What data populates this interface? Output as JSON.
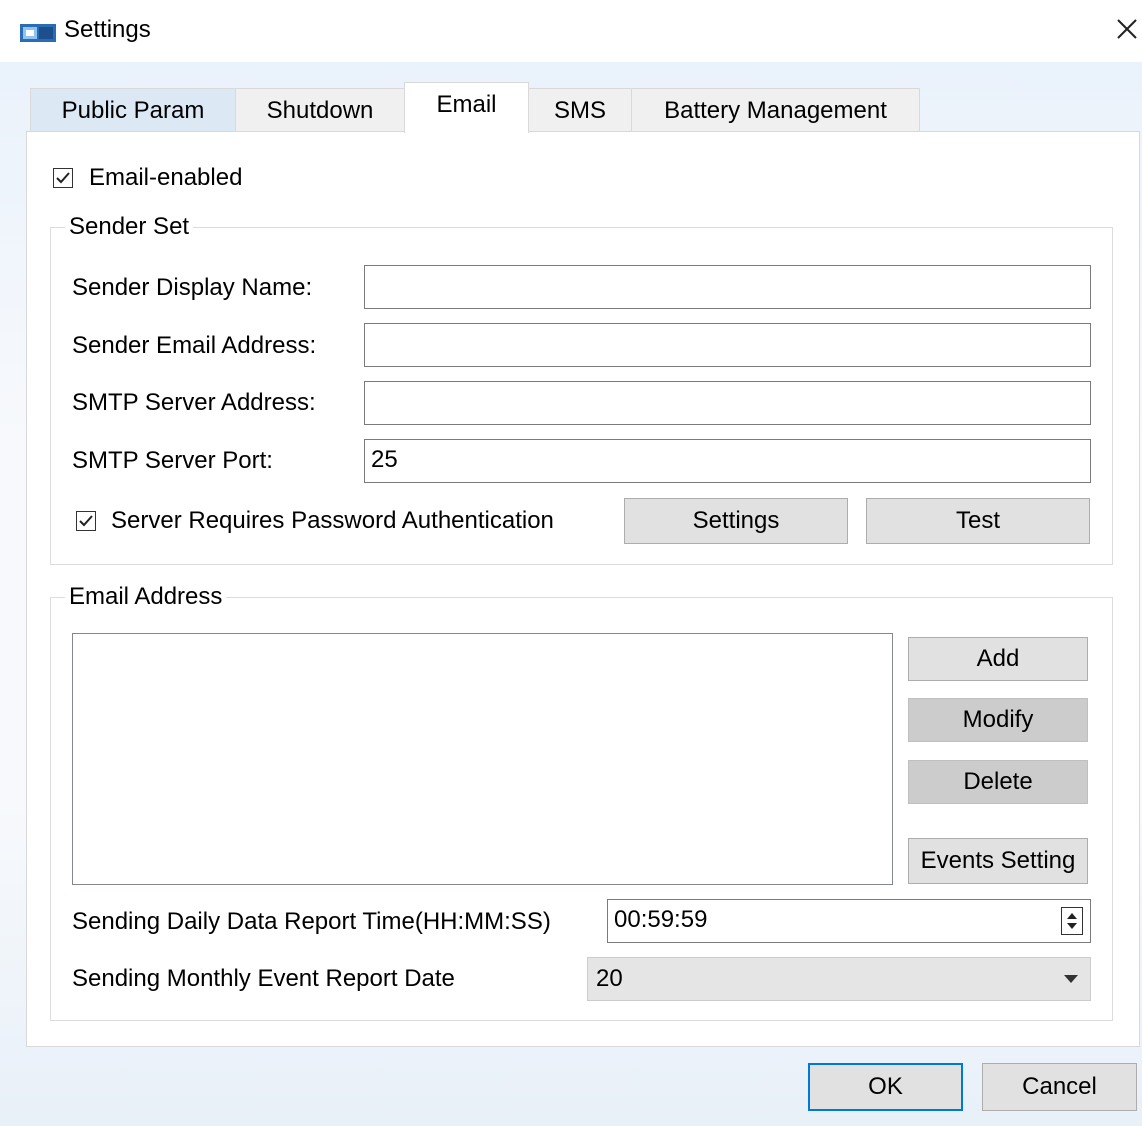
{
  "window": {
    "title": "Settings",
    "app_icon": "app-icon",
    "close_icon": "close-icon"
  },
  "tabs": [
    {
      "label": "Public Param",
      "active": false
    },
    {
      "label": "Shutdown",
      "active": false
    },
    {
      "label": "Email",
      "active": true
    },
    {
      "label": "SMS",
      "active": false
    },
    {
      "label": "Battery Management",
      "active": false
    }
  ],
  "email_enabled": {
    "label": "Email-enabled",
    "checked": true
  },
  "sender_set": {
    "title": "Sender Set",
    "display_name": {
      "label": "Sender Display Name:",
      "value": ""
    },
    "email_address": {
      "label": "Sender Email Address:",
      "value": ""
    },
    "smtp_address": {
      "label": "SMTP Server Address:",
      "value": ""
    },
    "smtp_port": {
      "label": "SMTP Server Port:",
      "value": "25"
    },
    "auth": {
      "label": "Server Requires Password Authentication",
      "checked": true
    },
    "settings_button": "Settings",
    "test_button": "Test"
  },
  "email_address": {
    "title": "Email Address",
    "items": [],
    "add_button": "Add",
    "modify_button": "Modify",
    "delete_button": "Delete",
    "events_button": "Events Setting",
    "daily_report": {
      "label": "Sending Daily Data Report Time(HH:MM:SS)",
      "value": "00:59:59"
    },
    "monthly_report": {
      "label": "Sending Monthly Event Report Date",
      "value": "20"
    }
  },
  "footer": {
    "ok_button": "OK",
    "cancel_button": "Cancel"
  }
}
